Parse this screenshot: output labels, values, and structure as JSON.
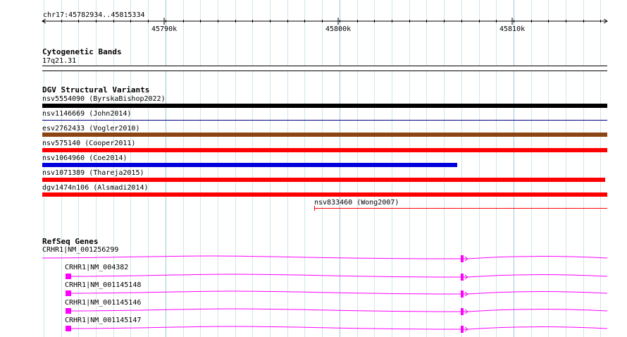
{
  "ruler": {
    "location": "chr17:45782934..45815334",
    "ticks": [
      "45790k",
      "45800k",
      "45810k"
    ]
  },
  "tracks": {
    "cytoband": {
      "title": "Cytogenetic Bands",
      "band": "17q21.31"
    },
    "dgv": {
      "title": "DGV Structural Variants",
      "variants": [
        {
          "label": "nsv5554090 (ByrskaBishop2022)",
          "color": "#000000",
          "style": "thick"
        },
        {
          "label": "nsv1146669 (John2014)",
          "color": "#000080",
          "style": "thin"
        },
        {
          "label": "esv2762433 (Vogler2010)",
          "color": "#8B4513",
          "style": "thick"
        },
        {
          "label": "nsv575140 (Cooper2011)",
          "color": "#ff0000",
          "style": "thick"
        },
        {
          "label": "nsv1064960 (Coe2014)",
          "color": "#0000dd",
          "style": "thick"
        },
        {
          "label": "nsv1071389 (Thareja2015)",
          "color": "#ff0000",
          "style": "thick"
        },
        {
          "label": "dgv1474n106 (Alsmadi2014)",
          "color": "#ff0000",
          "style": "thick"
        },
        {
          "label": "nsv833460 (Wong2007)",
          "color": "#ff0000",
          "style": "thin"
        }
      ]
    },
    "refseq": {
      "title": "RefSeq Genes",
      "color": "#ff00ff",
      "transcripts": [
        {
          "label": "CRHR1|NM_001256299"
        },
        {
          "label": "CRHR1|NM_004382"
        },
        {
          "label": "CRHR1|NM_001145148"
        },
        {
          "label": "CRHR1|NM_001145146"
        },
        {
          "label": "CRHR1|NM_001145147"
        }
      ]
    }
  }
}
